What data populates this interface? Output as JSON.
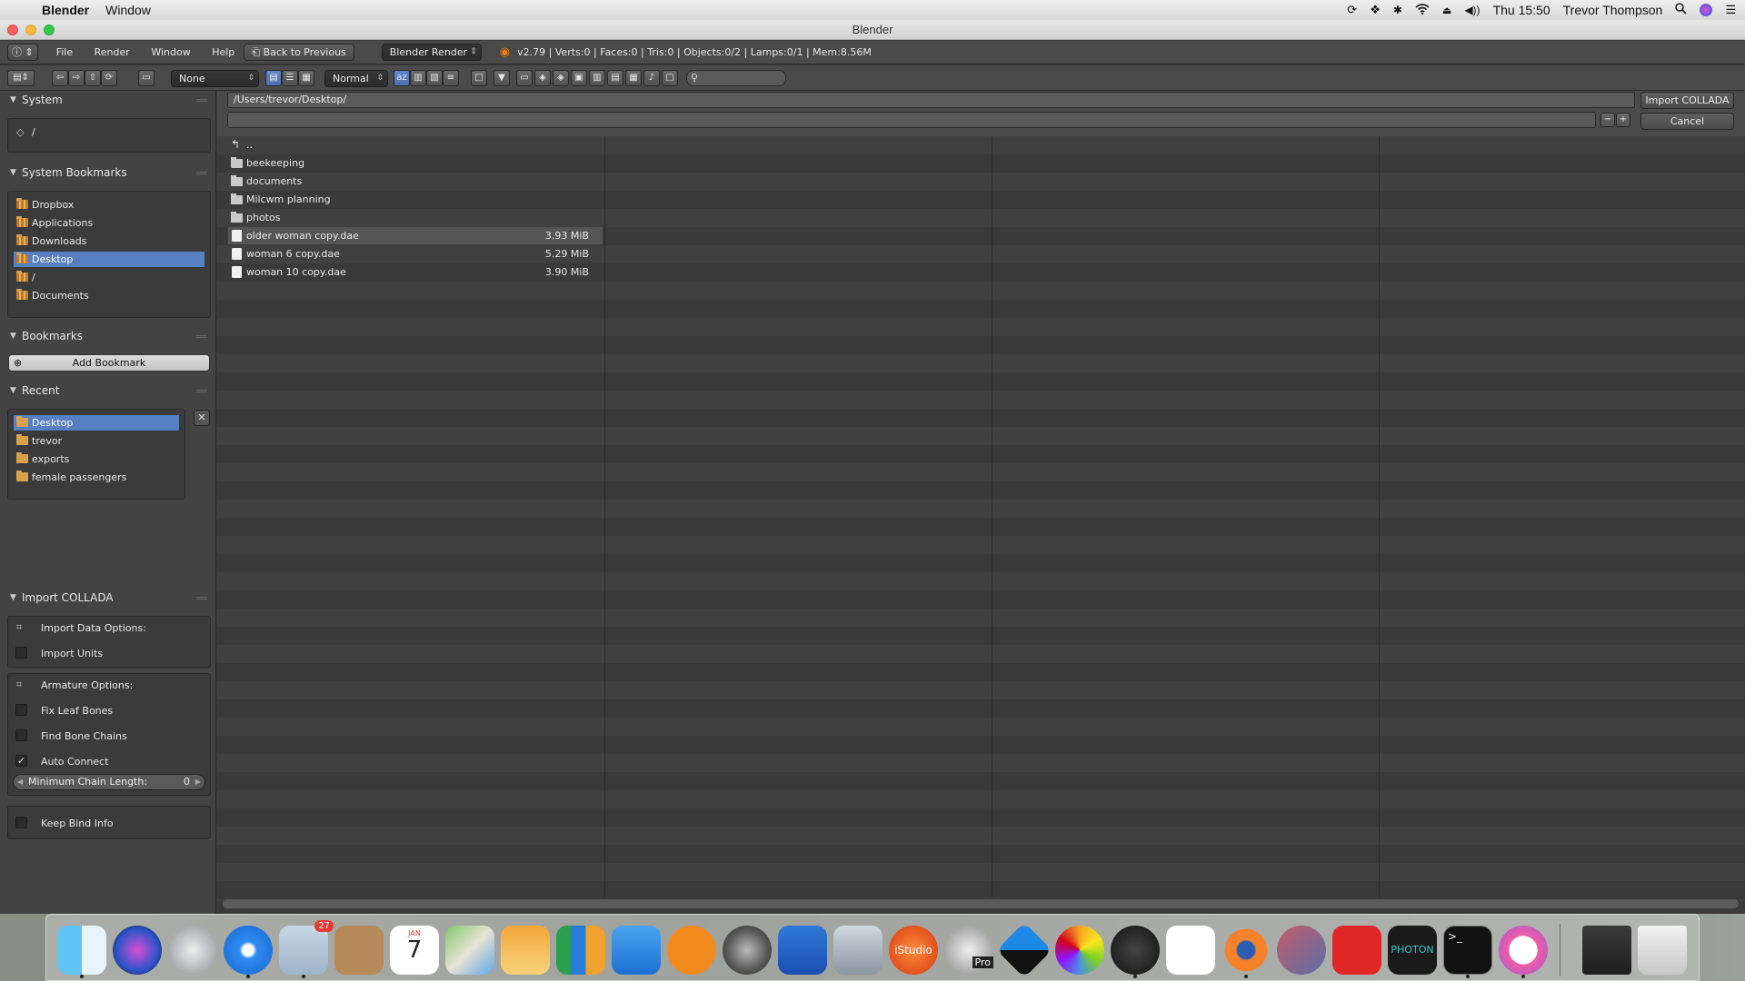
{
  "macos_menubar": {
    "app_name": "Blender",
    "menus": [
      "Window"
    ],
    "clock": "Thu 15:50",
    "user": "Trevor Thompson"
  },
  "window": {
    "title": "Blender"
  },
  "info_header": {
    "menus": [
      "File",
      "Render",
      "Window",
      "Help"
    ],
    "back_button": "Back to Previous",
    "render_engine": "Blender Render",
    "stats": "v2.79 | Verts:0 | Faces:0 | Tris:0 | Objects:0/2 | Lamps:0/1 | Mem:8.56M"
  },
  "file_header": {
    "recursion": "None",
    "display_size": "Normal",
    "sort_label": "az"
  },
  "sidebar": {
    "system": {
      "title": "System",
      "items": [
        "/"
      ]
    },
    "system_bookmarks": {
      "title": "System Bookmarks",
      "items": [
        "Dropbox",
        "Applications",
        "Downloads",
        "Desktop",
        "/",
        "Documents"
      ],
      "selected": "Desktop"
    },
    "bookmarks": {
      "title": "Bookmarks",
      "add_label": "Add Bookmark"
    },
    "recent": {
      "title": "Recent",
      "items": [
        "Desktop",
        "trevor",
        "exports",
        "female passengers"
      ],
      "selected": "Desktop"
    },
    "import_collada": {
      "title": "Import COLLADA",
      "import_data_options": "Import Data Options:",
      "import_units": "Import Units",
      "armature_options": "Armature Options:",
      "fix_leaf_bones": "Fix Leaf Bones",
      "find_bone_chains": "Find Bone Chains",
      "auto_connect": "Auto Connect",
      "auto_connect_checked": true,
      "min_chain_label": "Minimum Chain Length:",
      "min_chain_value": "0",
      "keep_bind_info": "Keep Bind Info"
    }
  },
  "file_browser": {
    "directory": "/Users/trevor/Desktop/",
    "filename": "",
    "import_button": "Import COLLADA",
    "cancel_button": "Cancel",
    "parent": "..",
    "folders": [
      "beekeeping",
      "documents",
      "Milcwm planning",
      "photos"
    ],
    "files": [
      {
        "name": "older woman copy.dae",
        "size": "3.93 MiB"
      },
      {
        "name": "woman 6 copy.dae",
        "size": "5.29 MiB"
      },
      {
        "name": "woman 10 copy.dae",
        "size": "3.90 MiB"
      }
    ]
  },
  "dock": {
    "calendar_month": "JAN",
    "calendar_day": "7",
    "mail_badge": "27",
    "istudio_label": "iStudio",
    "pro_label": "Pro",
    "photon_label": "PHOTON",
    "terminal_prompt": ">_"
  }
}
